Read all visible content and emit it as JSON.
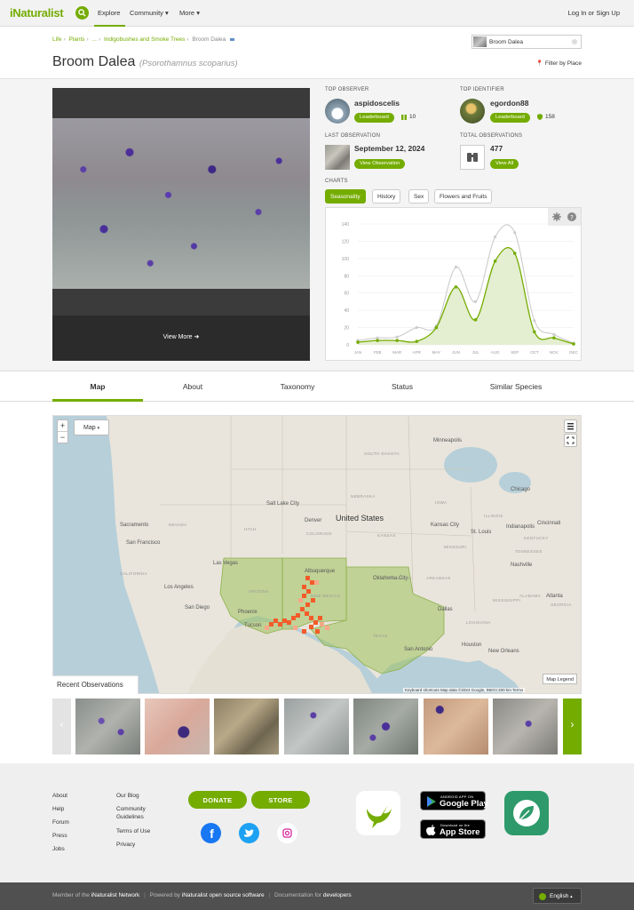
{
  "header": {
    "logo": "iNaturalist",
    "nav": {
      "explore": "Explore",
      "community": "Community",
      "more": "More"
    },
    "login": "Log In or Sign Up"
  },
  "breadcrumb": {
    "items": [
      "Life",
      "Plants",
      "...",
      "Indigobushes and Smoke Trees",
      "Broom Dalea"
    ]
  },
  "taxon_search": {
    "value": "Broom Dalea"
  },
  "taxon": {
    "common_name": "Broom Dalea",
    "scientific_name": "(Psorothamnus scoparius)",
    "filter_by_place": "Filter by Place"
  },
  "photo": {
    "view_more": "View More"
  },
  "stats": {
    "top_observer": {
      "label": "TOP OBSERVER",
      "name": "aspidoscelis",
      "button": "Leaderboard",
      "count": "10"
    },
    "top_identifier": {
      "label": "TOP IDENTIFIER",
      "name": "egordon88",
      "button": "Leaderboard",
      "count": "158"
    },
    "last_observation": {
      "label": "LAST OBSERVATION",
      "date": "September 12, 2024",
      "button": "View Observation"
    },
    "total_observations": {
      "label": "TOTAL OBSERVATIONS",
      "count": "477",
      "button": "View All"
    }
  },
  "charts": {
    "label": "CHARTS",
    "tabs": [
      "Seasonality",
      "History",
      "Sex",
      "Flowers and Fruits"
    ],
    "active_tab": "Seasonality",
    "colors": {
      "main": "#74ac00",
      "fill": "#e4eed1",
      "secondary": "#cccccc"
    }
  },
  "chart_data": {
    "type": "area",
    "categories": [
      "JAN",
      "FEB",
      "MAR",
      "APR",
      "MAY",
      "JUN",
      "JUL",
      "AUG",
      "SEP",
      "OCT",
      "NOV",
      "DEC"
    ],
    "yticks": [
      0,
      20,
      40,
      60,
      80,
      100,
      120,
      140
    ],
    "ylim": [
      0,
      140
    ],
    "series": [
      {
        "values": [
          3,
          5,
          5,
          4,
          20,
          67,
          29,
          97,
          106,
          15,
          8,
          1
        ]
      },
      {
        "values": [
          5,
          8,
          9,
          20,
          22,
          90,
          50,
          125,
          130,
          28,
          12,
          2
        ]
      }
    ]
  },
  "tabs": {
    "items": [
      "Map",
      "About",
      "Taxonomy",
      "Status",
      "Similar Species"
    ],
    "active": "Map"
  },
  "map": {
    "zoom_in": "+",
    "zoom_out": "−",
    "map_type": "Map",
    "legend": "Map Legend",
    "attribution": "Keyboard shortcuts   Map data ©2024 Google, INEGI   200 km   Terms",
    "labels": {
      "country": "United States",
      "cities": [
        "Minneapolis",
        "Chicago",
        "Denver",
        "Kansas City",
        "St. Louis",
        "Indianapolis",
        "Cincinnati",
        "Sacramento",
        "San Francisco",
        "Las Vegas",
        "Los Angeles",
        "San Diego",
        "Phoenix",
        "Tucson",
        "Albuquerque",
        "Dallas",
        "Houston",
        "San Antonio",
        "Nashville",
        "Atlanta",
        "New Orleans",
        "Salt Lake City",
        "Oklahoma City"
      ],
      "states": [
        "SOUTH DAKOTA",
        "NEBRASKA",
        "IOWA",
        "KANSAS",
        "MISSOURI",
        "ILLINOIS",
        "COLORADO",
        "UTAH",
        "NEVADA",
        "CALIFORNIA",
        "ARIZONA",
        "NEW MEXICO",
        "TEXAS",
        "OKLAHOMA",
        "ARKANSAS",
        "TENNESSEE",
        "ALABAMA",
        "GEORGIA",
        "MISSISSIPPI",
        "LOUISIANA",
        "KENTUCKY"
      ]
    }
  },
  "recent_observations": {
    "label": "Recent Observations"
  },
  "footer": {
    "col1": [
      "About",
      "Help",
      "Forum",
      "Press",
      "Jobs"
    ],
    "col2": [
      "Our Blog",
      "Community Guidelines",
      "Terms of Use",
      "Privacy"
    ],
    "donate": "DONATE",
    "store": "STORE",
    "google_play_small": "ANDROID APP ON",
    "google_play_big": "Google Play",
    "app_store_small": "Download on the",
    "app_store_big": "App Store",
    "bottom": {
      "member": "Member of the",
      "network": "iNaturalist Network",
      "powered": "Powered by",
      "software": "iNaturalist open source software",
      "docs": "Documentation for",
      "developers": "developers"
    },
    "language": "English"
  }
}
